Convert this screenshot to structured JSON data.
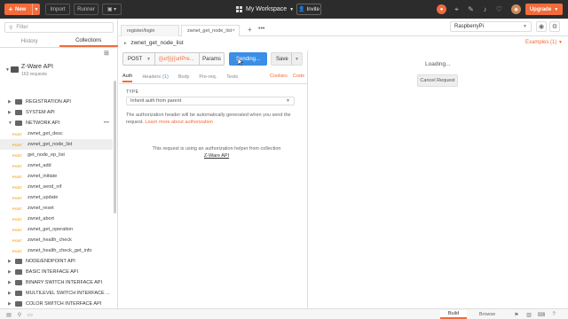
{
  "topbar": {
    "new_label": "New",
    "import_label": "Import",
    "runner_label": "Runner",
    "workspace_label": "My Workspace",
    "invite_label": "Invite",
    "upgrade_label": "Upgrade",
    "avatar_initial": "",
    "accent": "#f26b3a"
  },
  "sidebar": {
    "filter_placeholder": "Filter",
    "tabs": [
      "History",
      "Collections"
    ],
    "collection": {
      "name": "Z-Ware API",
      "count": "163 requests"
    },
    "tree": [
      {
        "kind": "folder",
        "label": "REGISTRATION API"
      },
      {
        "kind": "folder",
        "label": "SYSTEM API"
      },
      {
        "kind": "folder",
        "label": "NETWORK API",
        "open": true
      },
      {
        "kind": "req",
        "method": "POST",
        "label": "zwnet_get_desc"
      },
      {
        "kind": "req",
        "method": "POST",
        "label": "zwnet_get_node_list",
        "active": true
      },
      {
        "kind": "req",
        "method": "POST",
        "label": "get_node_ep_list"
      },
      {
        "kind": "req",
        "method": "POST",
        "label": "zwnet_add"
      },
      {
        "kind": "req",
        "method": "POST",
        "label": "zwnet_initiate"
      },
      {
        "kind": "req",
        "method": "POST",
        "label": "zwnet_send_nif"
      },
      {
        "kind": "req",
        "method": "POST",
        "label": "zwnet_update"
      },
      {
        "kind": "req",
        "method": "POST",
        "label": "zwnet_reset"
      },
      {
        "kind": "req",
        "method": "POST",
        "label": "zwnet_abort"
      },
      {
        "kind": "req",
        "method": "POST",
        "label": "zwnet_get_operation"
      },
      {
        "kind": "req",
        "method": "POST",
        "label": "zwnet_health_check"
      },
      {
        "kind": "req",
        "method": "POST",
        "label": "zwnet_health_check_get_info"
      },
      {
        "kind": "folder",
        "label": "NODE/ENDPOINT API"
      },
      {
        "kind": "folder",
        "label": "BASIC INTERFACE API"
      },
      {
        "kind": "folder",
        "label": "BINARY SWITCH INTERFACE API"
      },
      {
        "kind": "folder",
        "label": "MULTILEVEL SWITCH INTERFACE ..."
      },
      {
        "kind": "folder",
        "label": "COLOR SWITCH INTERFACE API"
      },
      {
        "kind": "folder",
        "label": "BINARY SENSOR INTERFACE API"
      }
    ]
  },
  "main": {
    "tabs": [
      {
        "label": "register/login"
      },
      {
        "label": "zwnet_get_node_list",
        "active": true
      }
    ],
    "environment": "RaspberryPi",
    "request_title": "zwnet_get_node_list",
    "examples_label": "Examples (1)",
    "method": "POST",
    "url": "{{url}}{{urlPre...",
    "params_label": "Params",
    "send_label": "Sending...",
    "save_label": "Save",
    "request_tabs": [
      {
        "label": "Auth",
        "active": true
      },
      {
        "label": "Headers",
        "badge": "(1)"
      },
      {
        "label": "Body"
      },
      {
        "label": "Pre-req."
      },
      {
        "label": "Tests"
      }
    ],
    "cookies_label": "Cookies",
    "code_label": "Code",
    "type_label": "TYPE",
    "type_value": "Inherit auth from parent",
    "auth_note": "The authorization header will be automatically generated when you send the request.",
    "auth_link": "Learn more about authorization",
    "helper_text": "This request is using an authorization helper from collection",
    "helper_link": "Z-Ware API",
    "loading_text": "Loading...",
    "cancel_label": "Cancel Request"
  },
  "bottombar": {
    "build_label": "Build",
    "browse_label": "Browse"
  }
}
